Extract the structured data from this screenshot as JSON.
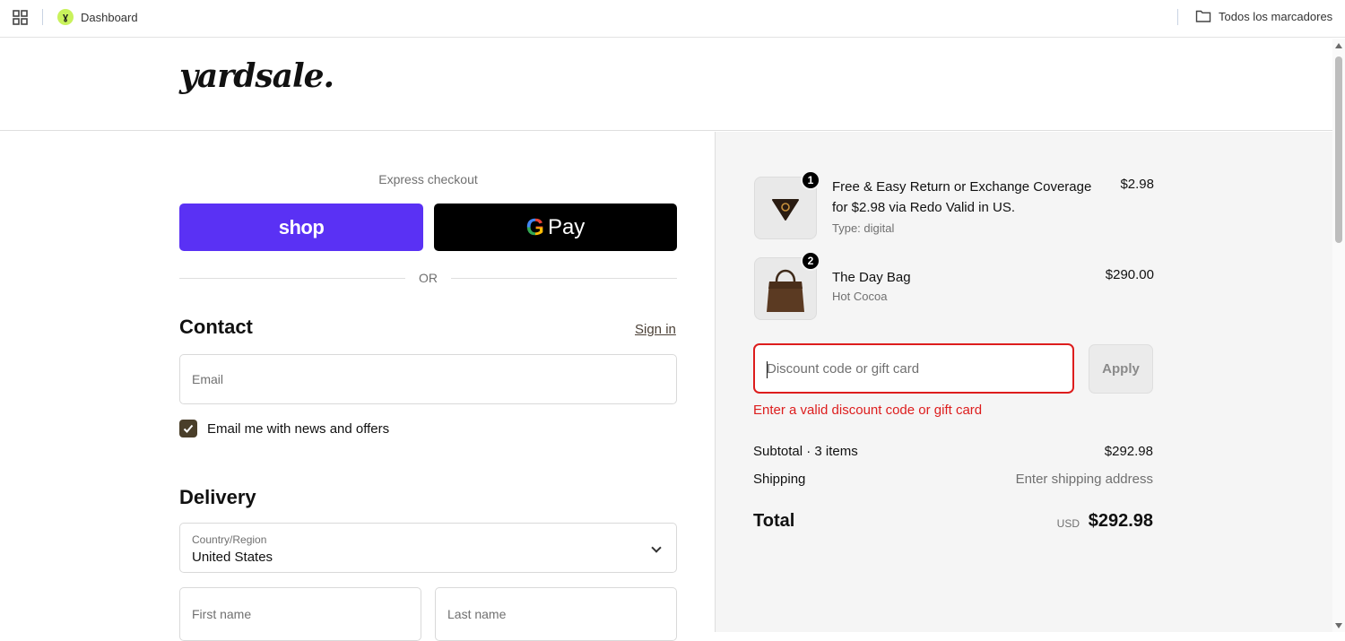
{
  "bookmarks_bar": {
    "dashboard": {
      "label": "Dashboard",
      "icon": "dashboard-favicon-icon"
    },
    "all_bookmarks": {
      "label": "Todos los marcadores",
      "icon": "folder-icon"
    }
  },
  "header": {
    "logo_text": "yardsale."
  },
  "express": {
    "label": "Express checkout",
    "shop_pay_label": "shop",
    "gpay_label": "Pay",
    "gpay_g": "G",
    "or_label": "OR"
  },
  "contact": {
    "heading": "Contact",
    "sign_in": "Sign in",
    "email_placeholder": "Email",
    "newsletter_label": "Email me with news and offers",
    "newsletter_checked": true
  },
  "delivery": {
    "heading": "Delivery",
    "country_label": "Country/Region",
    "country_value": "United States",
    "first_name_placeholder": "First name",
    "last_name_placeholder": "Last name"
  },
  "order": {
    "items": [
      {
        "quantity": "1",
        "name": "Free & Easy Return or Exchange Coverage for $2.98 via Redo Valid in US.",
        "detail": "Type: digital",
        "price": "$2.98"
      },
      {
        "quantity": "2",
        "name": "The Day Bag",
        "detail": "Hot Cocoa",
        "price": "$290.00"
      }
    ],
    "discount_placeholder": "Discount code or gift card",
    "apply_label": "Apply",
    "discount_error": "Enter a valid discount code or gift card",
    "subtotal_label": "Subtotal · 3 items",
    "subtotal_value": "$292.98",
    "shipping_label": "Shipping",
    "shipping_value": "Enter shipping address",
    "total_label": "Total",
    "total_currency": "USD",
    "total_value": "$292.98"
  },
  "colors": {
    "shop_pay": "#5a31f4",
    "gpay": "#000000",
    "error": "#dd1d1d",
    "checkbox": "#4a3f2a"
  }
}
